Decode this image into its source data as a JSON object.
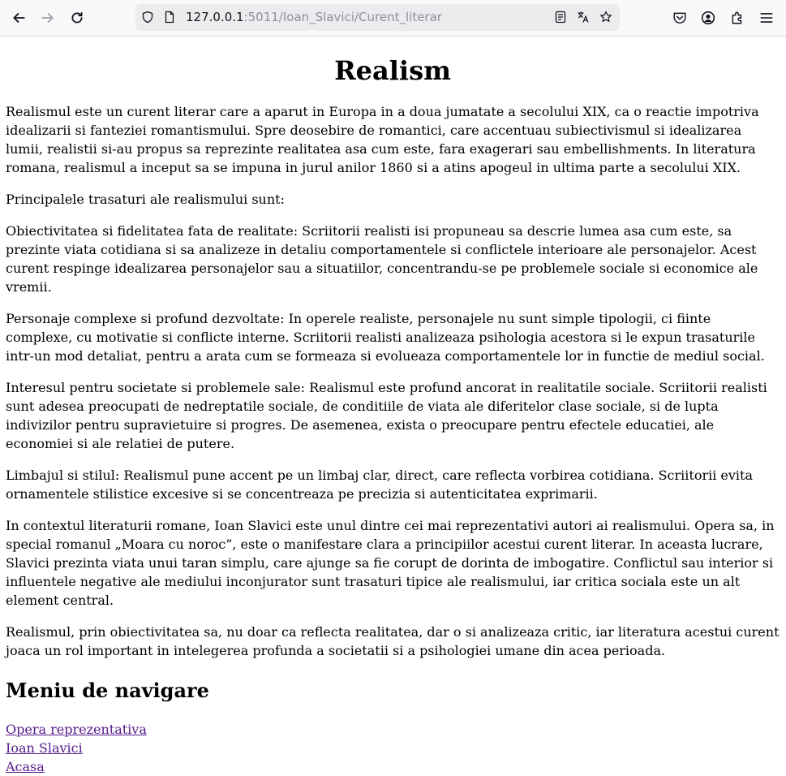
{
  "browser": {
    "url_host": "127.0.0.1",
    "url_path": ":5011/Ioan_Slavici/Curent_literar"
  },
  "page": {
    "title": "Realism",
    "paragraphs": [
      "Realismul este un curent literar care a aparut in Europa in a doua jumatate a secolului XIX, ca o reactie impotriva idealizarii si fanteziei romantismului. Spre deosebire de romantici, care accentuau subiectivismul si idealizarea lumii, realistii si-au propus sa reprezinte realitatea asa cum este, fara exagerari sau embellishments. In literatura romana, realismul a inceput sa se impuna in jurul anilor 1860 si a atins apogeul in ultima parte a secolului XIX.",
      "Principalele trasaturi ale realismului sunt:",
      "Obiectivitatea si fidelitatea fata de realitate: Scriitorii realisti isi propuneau sa descrie lumea asa cum este, sa prezinte viata cotidiana si sa analizeze in detaliu comportamentele si conflictele interioare ale personajelor. Acest curent respinge idealizarea personajelor sau a situatiilor, concentrandu-se pe problemele sociale si economice ale vremii.",
      "Personaje complexe si profund dezvoltate: In operele realiste, personajele nu sunt simple tipologii, ci fiinte complexe, cu motivatie si conflicte interne. Scriitorii realisti analizeaza psihologia acestora si le expun trasaturile intr-un mod detaliat, pentru a arata cum se formeaza si evolueaza comportamentele lor in functie de mediul social.",
      "Interesul pentru societate si problemele sale: Realismul este profund ancorat in realitatile sociale. Scriitorii realisti sunt adesea preocupati de nedreptatile sociale, de conditiile de viata ale diferitelor clase sociale, si de lupta indivizilor pentru supravietuire si progres. De asemenea, exista o preocupare pentru efectele educatiei, ale economiei si ale relatiei de putere.",
      "Limbajul si stilul: Realismul pune accent pe un limbaj clar, direct, care reflecta vorbirea cotidiana. Scriitorii evita ornamentele stilistice excesive si se concentreaza pe precizia si autenticitatea exprimarii.",
      "In contextul literaturii romane, Ioan Slavici este unul dintre cei mai reprezentativi autori ai realismului. Opera sa, in special romanul „Moara cu noroc”, este o manifestare clara a principiilor acestui curent literar. In aceasta lucrare, Slavici prezinta viata unui taran simplu, care ajunge sa fie corupt de dorinta de imbogatire. Conflictul sau interior si influentele negative ale mediului inconjurator sunt trasaturi tipice ale realismului, iar critica sociala este un alt element central.",
      "Realismul, prin obiectivitatea sa, nu doar ca reflecta realitatea, dar o si analizeaza critic, iar literatura acestui curent joaca un rol important in intelegerea profunda a societatii si a psihologiei umane din acea perioada."
    ],
    "nav_heading": "Meniu de navigare",
    "nav_links": [
      "Opera reprezentativa",
      "Ioan Slavici",
      "Acasa"
    ]
  },
  "colors": {
    "link_visited": "#551a8b",
    "toolbar_bg": "#f9f9fb",
    "urlbar_bg": "#ececef"
  }
}
